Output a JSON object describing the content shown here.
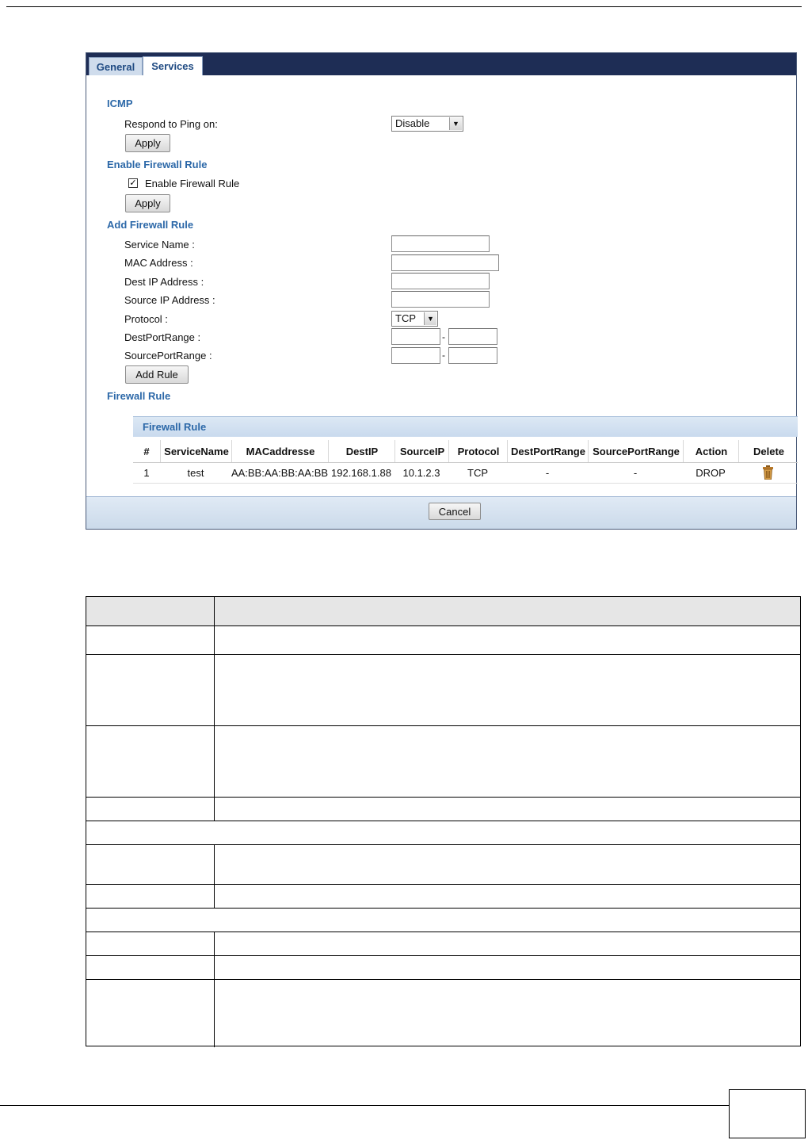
{
  "tabs": {
    "general": "General",
    "services": "Services"
  },
  "icmp": {
    "title": "ICMP",
    "respond_label": "Respond to Ping on:",
    "respond_value": "Disable",
    "apply": "Apply"
  },
  "enable_rule": {
    "title": "Enable Firewall Rule",
    "checkbox_label": "Enable Firewall Rule",
    "checked": true,
    "apply": "Apply"
  },
  "add_rule": {
    "title": "Add Firewall Rule",
    "service_name": "Service Name :",
    "mac_address": "MAC Address :",
    "dest_ip": "Dest IP Address :",
    "source_ip": "Source IP Address :",
    "protocol": "Protocol :",
    "protocol_value": "TCP",
    "dest_port": "DestPortRange :",
    "source_port": "SourcePortRange :",
    "dash": "-",
    "add_button": "Add Rule"
  },
  "firewall_rule": {
    "section_title": "Firewall Rule",
    "table_title": "Firewall Rule",
    "columns": [
      "#",
      "ServiceName",
      "MACaddresse",
      "DestIP",
      "SourceIP",
      "Protocol",
      "DestPortRange",
      "SourcePortRange",
      "Action",
      "Delete"
    ],
    "rows": [
      [
        "1",
        "test",
        "AA:BB:AA:BB:AA:BB",
        "192.168.1.88",
        "10.1.2.3",
        "TCP",
        "-",
        "-",
        "DROP"
      ]
    ]
  },
  "footer": {
    "cancel": "Cancel"
  },
  "icons": {
    "delete": "trash-icon",
    "dropdown": "chevron-down-icon",
    "check": "checkmark-icon"
  },
  "colors": {
    "tabbar": "#1e2d55",
    "section_title": "#2c68a8",
    "panel": "#c9daee"
  }
}
